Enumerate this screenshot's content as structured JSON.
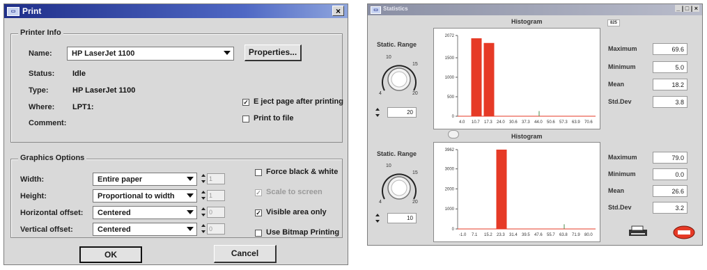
{
  "print_dialog": {
    "title": "Print",
    "close_symbol": "×",
    "printer_info": {
      "legend": "Printer Info",
      "name_label": "Name:",
      "name_value": "HP LaserJet 1100",
      "properties_button": "Properties...",
      "status_label": "Status:",
      "status_value": "Idle",
      "type_label": "Type:",
      "type_value": "HP LaserJet 1100",
      "where_label": "Where:",
      "where_value": "LPT1:",
      "comment_label": "Comment:",
      "eject_label": "E ject page after printing",
      "eject_checked": true,
      "print_to_file_label": "Print to file",
      "print_to_file_checked": false
    },
    "graphics_options": {
      "legend": "Graphics Options",
      "width_label": "Width:",
      "width_value": "Entire paper",
      "width_spin": "1",
      "height_label": "Height:",
      "height_value": "Proportional to width",
      "height_spin": "1",
      "hoffset_label": "Horizontal offset:",
      "hoffset_value": "Centered",
      "hoffset_spin": "0",
      "voffset_label": "Vertical offset:",
      "voffset_value": "Centered",
      "voffset_spin": "0",
      "force_bw_label": "Force black & white",
      "force_bw_checked": false,
      "scale_label": "Scale to screen",
      "scale_checked": true,
      "visible_label": "Visible area only",
      "visible_checked": true,
      "bitmap_label": "Use Bitmap Printing",
      "bitmap_checked": false
    },
    "ok_button": "OK",
    "cancel_button": "Cancel"
  },
  "stats_window": {
    "title": "Statistics",
    "title_controls": "_ | □ | ×",
    "panels": [
      {
        "range_label": "Static. Range",
        "knob_ticks": [
          "10",
          "15",
          "4",
          "20"
        ],
        "range_value": "20",
        "stats": [
          {
            "label": "Maximum",
            "value": "69.6"
          },
          {
            "label": "Minimum",
            "value": "5.0"
          },
          {
            "label": "Mean",
            "value": "18.2"
          },
          {
            "label": "Std.Dev",
            "value": "3.8"
          }
        ]
      },
      {
        "range_label": "Static. Range",
        "knob_ticks": [
          "10",
          "15",
          "4",
          "20"
        ],
        "range_value": "10",
        "stats": [
          {
            "label": "Maximum",
            "value": "79.0"
          },
          {
            "label": "Minimum",
            "value": "0.0"
          },
          {
            "label": "Mean",
            "value": "26.6"
          },
          {
            "label": "Std.Dev",
            "value": "3.2"
          }
        ]
      }
    ],
    "colors": {
      "bar": "#e63a26",
      "panel": "#d9d9d9"
    }
  },
  "chart_data": [
    {
      "type": "bar",
      "title": "Histogram",
      "corner_value": "825",
      "categories": [
        "4.0",
        "10.7",
        "17.3",
        "24.0",
        "30.6",
        "37.3",
        "44.0",
        "50.6",
        "57.3",
        "63.9",
        "70.6"
      ],
      "values": [
        0,
        2000,
        1880,
        0,
        0,
        0,
        25,
        0,
        0,
        0,
        0
      ],
      "yticks": [
        "0",
        "500",
        "1000",
        "1500",
        "2072"
      ],
      "ylim": [
        0,
        2072
      ]
    },
    {
      "type": "bar",
      "title": "Histogram",
      "categories": [
        "-1.0",
        "7.1",
        "15.2",
        "23.3",
        "31.4",
        "39.5",
        "47.6",
        "55.7",
        "63.8",
        "71.9",
        "80.0"
      ],
      "values": [
        0,
        0,
        0,
        3962,
        0,
        0,
        0,
        0,
        25,
        0,
        0
      ],
      "yticks": [
        "0",
        "1000",
        "2000",
        "3000",
        "3962"
      ],
      "ylim": [
        0,
        3962
      ]
    }
  ]
}
